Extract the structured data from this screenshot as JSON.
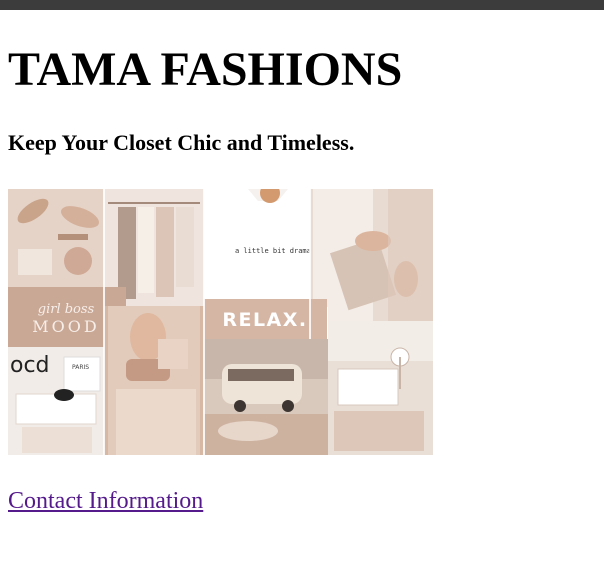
{
  "page": {
    "title": "TAMA FASHIONS",
    "tagline": "Keep Your Closet Chic and Timeless.",
    "contact_link": "Contact Information"
  },
  "collage": {
    "texts": {
      "girl_boss": "girl boss",
      "mood": "MOOD",
      "relax": "RELAX.",
      "tee": "a little bit dramatic",
      "ocd": "ocd",
      "paris": "PARIS"
    },
    "colors": {
      "blush": "#e2c9bb",
      "nude": "#d9b9a6",
      "cream": "#f3ece6",
      "tan": "#c9a48b",
      "topbar": "#3c3c3c",
      "link_visited": "#551a8b"
    }
  }
}
